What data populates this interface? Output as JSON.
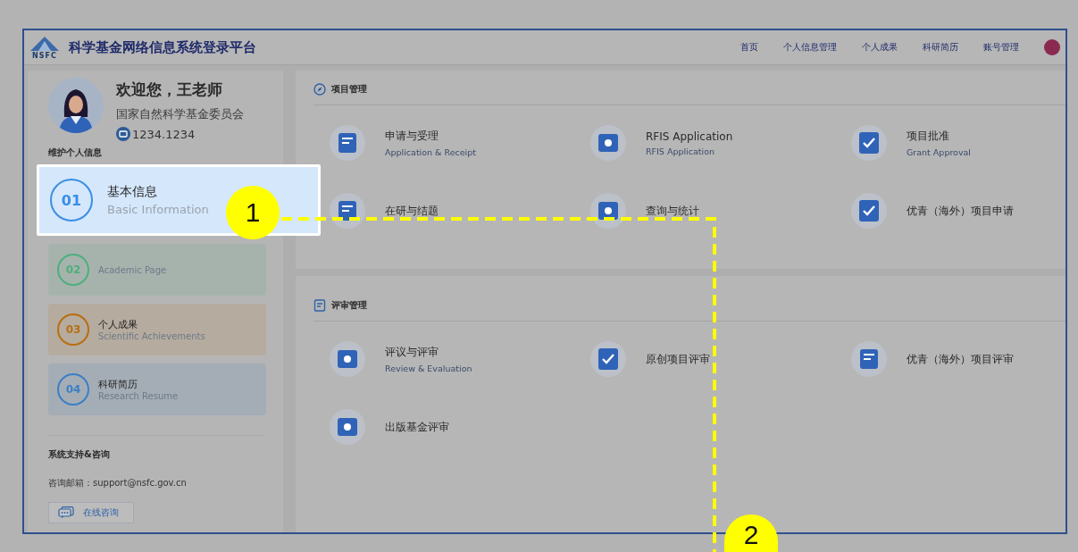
{
  "header": {
    "logo_text": "NSFC",
    "title": "科学基金网络信息系统登录平台",
    "nav": [
      {
        "label": "首页"
      },
      {
        "label": "个人信息管理"
      },
      {
        "label": "个人成果"
      },
      {
        "label": "科研简历"
      },
      {
        "label": "账号管理"
      }
    ]
  },
  "profile": {
    "greeting": "欢迎您，王老师",
    "organization": "国家自然科学基金委员会",
    "id_number": "1234.1234"
  },
  "maintain_heading": "维护个人信息",
  "cards": [
    {
      "number": "01",
      "title": "基本信息",
      "subtitle": "Basic Information",
      "color": "#3a8ee6",
      "selected": true
    },
    {
      "number": "02",
      "subtitle": "Academic Page",
      "color": "#4caf7d",
      "selected": false
    },
    {
      "number": "03",
      "title": "个人成果",
      "subtitle": "Scientific Achievements",
      "color": "#b86e10",
      "selected": false
    },
    {
      "number": "04",
      "title": "科研简历",
      "subtitle": "Research Resume",
      "color": "#3a7fc4",
      "selected": false
    }
  ],
  "support": {
    "heading": "系统支持&咨询",
    "email": "咨询邮箱：support@nsfc.gov.cn",
    "button": "在线咨询"
  },
  "sections": [
    {
      "title": "项目管理",
      "items": [
        {
          "title": "申请与受理",
          "subtitle": "Application & Receipt"
        },
        {
          "title": "RFIS Application",
          "subtitle": "RFIS Application"
        },
        {
          "title": "项目批准",
          "subtitle": "Grant Approval"
        },
        {
          "title": "在研与结题"
        },
        {
          "title": "查询与统计"
        },
        {
          "title": "优青（海外）项目申请"
        }
      ]
    },
    {
      "title": "评审管理",
      "items": [
        {
          "title": "评议与评审",
          "subtitle": "Review & Evaluation"
        },
        {
          "title": "原创项目评审"
        },
        {
          "title": "优青（海外）项目评审"
        },
        {
          "title": "出版基金评审"
        }
      ]
    }
  ],
  "annotations": [
    {
      "label": "1"
    },
    {
      "label": "2"
    }
  ]
}
